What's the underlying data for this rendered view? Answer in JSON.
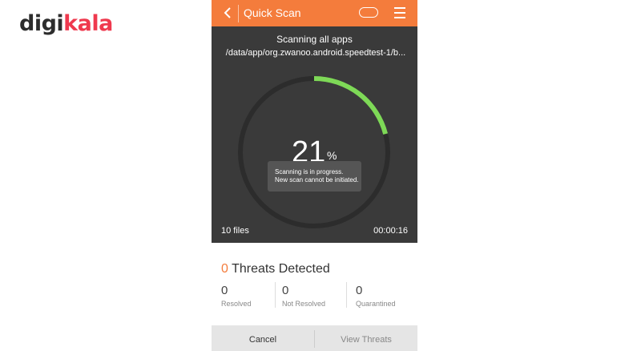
{
  "logo": {
    "part1": "digi",
    "part2": "kala"
  },
  "appbar": {
    "title": "Quick Scan"
  },
  "scan": {
    "title": "Scanning all apps",
    "path": "/data/app/org.zwanoo.android.speedtest-1/b...",
    "progress_percent": 21,
    "percent_text": "21",
    "percent_sign": "%",
    "files": "10 files",
    "elapsed": "00:00:16"
  },
  "toast": {
    "line1": "Scanning is in progress.",
    "line2": "New scan cannot be initiated."
  },
  "threats": {
    "count": "0",
    "label": "Threats Detected"
  },
  "stats": [
    {
      "value": "0",
      "label": "Resolved"
    },
    {
      "value": "0",
      "label": "Not Resolved"
    },
    {
      "value": "0",
      "label": "Quarantined"
    }
  ],
  "buttons": {
    "cancel": "Cancel",
    "view_threats": "View Threats"
  },
  "colors": {
    "accent": "#f47c3c",
    "progress": "#7ed957",
    "track": "#2c2c2c",
    "brand_red": "#ef394e"
  }
}
